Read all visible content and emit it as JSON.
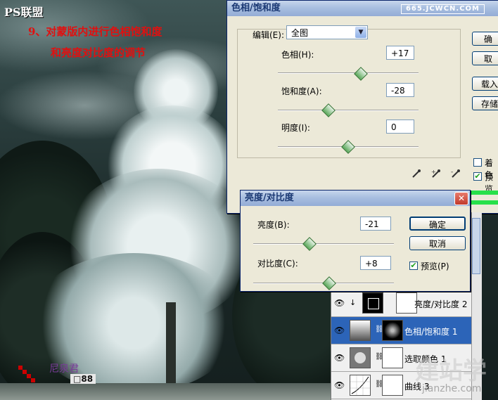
{
  "watermarks": {
    "top_left": "PS联盟",
    "top_url": "665.JCWCN.COM",
    "bottom_left": "尼泉君",
    "bottom_right_cn": "建站学",
    "bottom_right_url": "jianzhe.com"
  },
  "instruction": {
    "line1": "9、对蒙版内进行色相饱和度",
    "line2": "和亮度对比度的调节"
  },
  "hue_saturation": {
    "title": "色相/饱和度",
    "edit_label": "编辑(E):",
    "edit_value": "全图",
    "hue_label": "色相(H):",
    "hue_value": "+17",
    "saturation_label": "饱和度(A):",
    "saturation_value": "-28",
    "lightness_label": "明度(I):",
    "lightness_value": "0",
    "buttons": {
      "ok": "确",
      "cancel": "取",
      "load": "载入",
      "save": "存储"
    },
    "colorize_label": "着色",
    "preview_label": "预览",
    "preview_checked": true
  },
  "brightness_contrast": {
    "title": "亮度/对比度",
    "brightness_label": "亮度(B):",
    "brightness_value": "-21",
    "contrast_label": "对比度(C):",
    "contrast_value": "+8",
    "ok_label": "确定",
    "cancel_label": "取消",
    "preview_label": "预览(P)",
    "preview_checked": true,
    "close_glyph": "✕"
  },
  "layers": [
    {
      "name": "亮度/对比度 2",
      "selected": false
    },
    {
      "name": "色相/饱和度 1",
      "selected": true
    },
    {
      "name": "选取颜色 1",
      "selected": false
    },
    {
      "name": "曲线 3",
      "selected": false
    }
  ],
  "colors": {
    "title_text": "#1a3873",
    "instruction_text": "#e01010",
    "selected_row": "#2c64b8",
    "slider_thumb": "#5aa85a"
  }
}
